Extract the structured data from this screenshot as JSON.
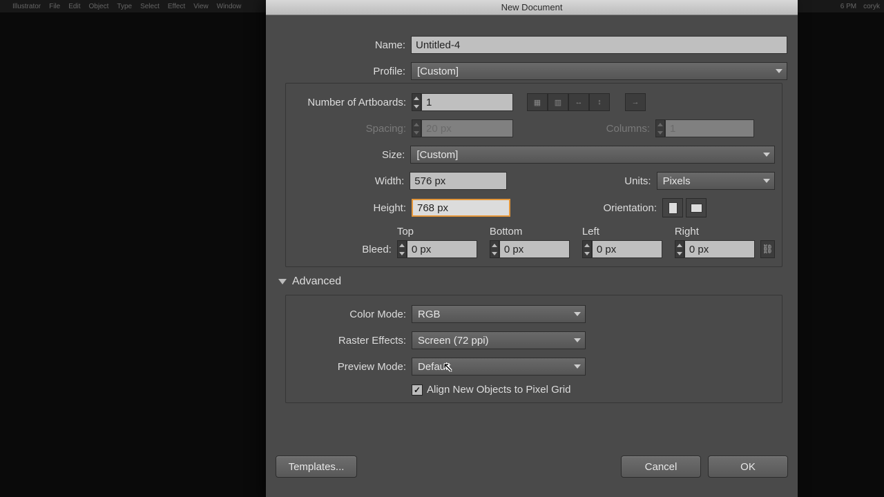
{
  "menubar": {
    "app": "Illustrator",
    "items": [
      "File",
      "Edit",
      "Object",
      "Type",
      "Select",
      "Effect",
      "View",
      "Window"
    ],
    "clock": "6 PM",
    "user": "coryk"
  },
  "dialog": {
    "title": "New Document",
    "name_label": "Name:",
    "name": "Untitled-4",
    "profile_label": "Profile:",
    "profile": "[Custom]",
    "artboards_label": "Number of Artboards:",
    "artboards": "1",
    "spacing_label": "Spacing:",
    "spacing": "20 px",
    "columns_label": "Columns:",
    "columns": "1",
    "size_label": "Size:",
    "size": "[Custom]",
    "width_label": "Width:",
    "width": "576 px",
    "units_label": "Units:",
    "units": "Pixels",
    "height_label": "Height:",
    "height": "768 px",
    "orientation_label": "Orientation:",
    "bleed_label": "Bleed:",
    "bleed": {
      "top_label": "Top",
      "top": "0 px",
      "bottom_label": "Bottom",
      "bottom": "0 px",
      "left_label": "Left",
      "left": "0 px",
      "right_label": "Right",
      "right": "0 px"
    },
    "advanced_label": "Advanced",
    "color_mode_label": "Color Mode:",
    "color_mode": "RGB",
    "raster_label": "Raster Effects:",
    "raster": "Screen (72 ppi)",
    "preview_label": "Preview Mode:",
    "preview": "Default",
    "align_grid_label": "Align New Objects to Pixel Grid",
    "templates_label": "Templates...",
    "cancel_label": "Cancel",
    "ok_label": "OK"
  }
}
